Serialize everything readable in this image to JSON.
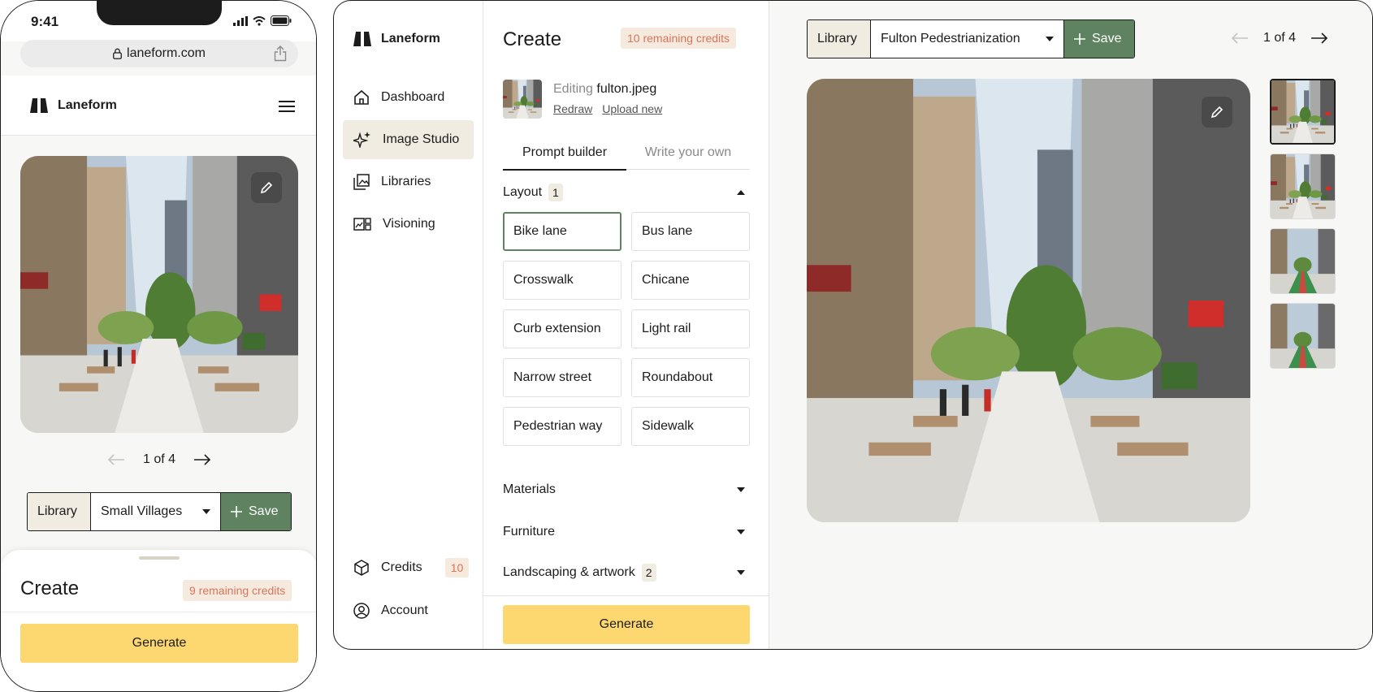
{
  "phone": {
    "status_time": "9:41",
    "url": "laneform.com",
    "brand": "Laneform",
    "pager": {
      "current": "1 of 4"
    },
    "library": {
      "label": "Library",
      "selected": "Small Villages",
      "save_label": "Save"
    },
    "sheet": {
      "title": "Create",
      "credits": "9 remaining credits",
      "generate_label": "Generate"
    }
  },
  "desktop": {
    "brand": "Laneform",
    "nav": [
      {
        "label": "Dashboard",
        "icon": "home-icon"
      },
      {
        "label": "Image Studio",
        "icon": "sparkle-icon",
        "active": true
      },
      {
        "label": "Libraries",
        "icon": "gallery-icon"
      },
      {
        "label": "Visioning",
        "icon": "visioning-icon"
      }
    ],
    "nav_bottom": [
      {
        "label": "Credits",
        "icon": "cube-icon",
        "count": "10"
      },
      {
        "label": "Account",
        "icon": "user-circle-icon"
      }
    ],
    "create": {
      "title": "Create",
      "credits": "10 remaining credits",
      "editing_prefix": "Editing",
      "editing_file": "fulton.jpeg",
      "redraw_label": "Redraw",
      "upload_label": "Upload new",
      "tabs": [
        "Prompt builder",
        "Write your own"
      ],
      "sections": {
        "layout": {
          "label": "Layout",
          "count": "1",
          "expanded": true
        },
        "materials": {
          "label": "Materials"
        },
        "furniture": {
          "label": "Furniture"
        },
        "landscaping": {
          "label": "Landscaping & artwork",
          "count": "2"
        }
      },
      "layout_options": [
        {
          "label": "Bike lane",
          "selected": true
        },
        {
          "label": "Bus lane"
        },
        {
          "label": "Crosswalk"
        },
        {
          "label": "Chicane"
        },
        {
          "label": "Curb extension"
        },
        {
          "label": "Light rail"
        },
        {
          "label": "Narrow street"
        },
        {
          "label": "Roundabout"
        },
        {
          "label": "Pedestrian way"
        },
        {
          "label": "Sidewalk"
        }
      ],
      "generate_label": "Generate"
    },
    "canvas": {
      "library": {
        "label": "Library",
        "selected": "Fulton Pedestrianization",
        "save_label": "Save"
      },
      "pager": {
        "current": "1 of 4"
      }
    }
  },
  "colors": {
    "accent_green": "#5f8360",
    "generate_yellow": "#fdd870",
    "credits_text": "#d9755a",
    "credits_bg": "#f6eadf",
    "active_bg": "#f0ece1"
  }
}
